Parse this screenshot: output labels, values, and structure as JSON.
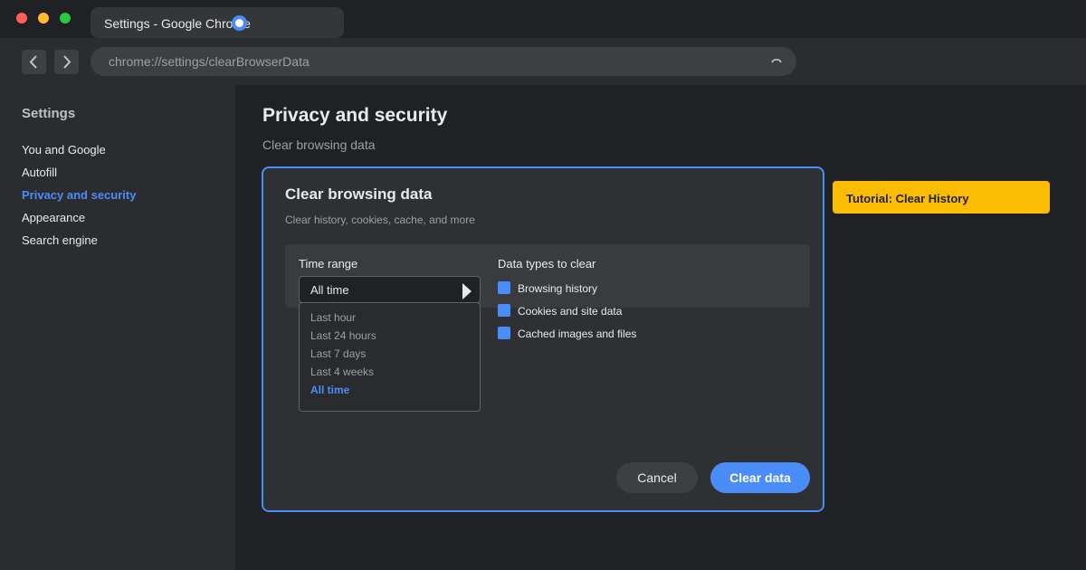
{
  "browser": {
    "tab_title": "Settings - Google Chrome",
    "url": "chrome://settings/clearBrowserData",
    "icons": {
      "back": "chevron-left-icon",
      "forward": "chevron-right-icon",
      "reload": "reload-icon",
      "favicon": "chrome-icon"
    }
  },
  "sidebar": {
    "title": "Settings",
    "items": [
      {
        "label": "You and Google",
        "active": false
      },
      {
        "label": "Autofill",
        "active": false
      },
      {
        "label": "Privacy and security",
        "active": true
      },
      {
        "label": "Appearance",
        "active": false
      },
      {
        "label": "Search engine",
        "active": false
      }
    ]
  },
  "main": {
    "title": "Privacy and security",
    "subtitle": "Clear browsing data"
  },
  "dialog": {
    "title": "Clear browsing data",
    "description": "Clear history, cookies, cache, and more",
    "time_range_label": "Time range",
    "time_range_value": "All time",
    "time_range_options": [
      "Last hour",
      "Last 24 hours",
      "Last 7 days",
      "Last 4 weeks",
      "All time"
    ],
    "selected_option": "All time",
    "data_types_label": "Data types to clear",
    "data_types": [
      {
        "label": "Browsing history",
        "checked": true
      },
      {
        "label": "Cookies and site data",
        "checked": true
      },
      {
        "label": "Cached images and files",
        "checked": true
      }
    ],
    "cancel_label": "Cancel",
    "clear_label": "Clear data"
  },
  "tutorial": {
    "label": "Tutorial: Clear History"
  },
  "colors": {
    "accent": "#4b8df8",
    "tutorial": "#fbbc04",
    "background": "#202124"
  }
}
